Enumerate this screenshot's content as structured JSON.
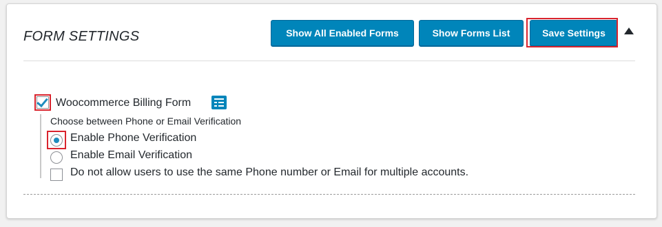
{
  "header": {
    "title": "FORM SETTINGS",
    "buttons": {
      "show_all_enabled_forms": "Show All Enabled Forms",
      "show_forms_list": "Show Forms List",
      "save_settings": "Save Settings"
    },
    "collapse_icon": "caret-up-icon"
  },
  "form": {
    "label": "Woocommerce Billing Form",
    "checked": true,
    "icon": "form-details-icon",
    "choose_label": "Choose between Phone or Email Verification",
    "options": [
      {
        "label": "Enable Phone Verification",
        "selected": true
      },
      {
        "label": "Enable Email Verification",
        "selected": false
      }
    ],
    "duplicate_restriction": {
      "label": "Do not allow users to use the same Phone number or Email for multiple accounts.",
      "checked": false
    }
  },
  "colors": {
    "primary_button": "#0085ba",
    "highlight": "#d9232d",
    "check": "#1e8cbe"
  }
}
